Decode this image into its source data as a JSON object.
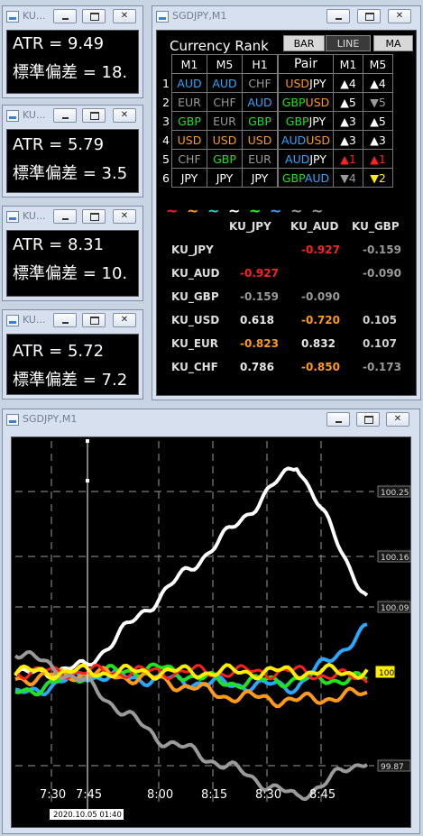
{
  "atr_windows": [
    {
      "title": "KU...",
      "atr_text": "ATR = 9.49",
      "sd_text": "標準偏差 = 18."
    },
    {
      "title": "KU...",
      "atr_text": "ATR = 5.79",
      "sd_text": "標準偏差 = 3.5"
    },
    {
      "title": "KU...",
      "atr_text": "ATR = 8.31",
      "sd_text": "標準偏差 = 10."
    },
    {
      "title": "KU...",
      "atr_text": "ATR = 5.72",
      "sd_text": "標準偏差 = 7.2"
    }
  ],
  "rank_window": {
    "title": "SGDJPY,M1",
    "heading": "Currency Rank",
    "tabs": [
      "BAR",
      "LINE",
      "MA"
    ],
    "active_tab": "LINE",
    "headers": [
      "M1",
      "M5",
      "H1",
      "Pair",
      "M1",
      "M5"
    ],
    "rows": [
      {
        "n": "1",
        "m1": "AUD",
        "m5": "AUD",
        "h1": "CHF",
        "pair_a": "USD",
        "pair_b": "JPY",
        "pm1": "▲4",
        "pm5": "▲4"
      },
      {
        "n": "2",
        "m1": "EUR",
        "m5": "CHF",
        "h1": "AUD",
        "pair_a": "GBP",
        "pair_b": "USD",
        "pm1": "▲5",
        "pm5": "▼5"
      },
      {
        "n": "3",
        "m1": "GBP",
        "m5": "EUR",
        "h1": "GBP",
        "pair_a": "GBP",
        "pair_b": "JPY",
        "pm1": "▲3",
        "pm5": "▲5"
      },
      {
        "n": "4",
        "m1": "USD",
        "m5": "USD",
        "h1": "USD",
        "pair_a": "AUD",
        "pair_b": "USD",
        "pm1": "▲3",
        "pm5": "▲3"
      },
      {
        "n": "5",
        "m1": "CHF",
        "m5": "GBP",
        "h1": "EUR",
        "pair_a": "AUD",
        "pair_b": "JPY",
        "pm1": "▲1",
        "pm5": "▲1"
      },
      {
        "n": "6",
        "m1": "JPY",
        "m5": "JPY",
        "h1": "JPY",
        "pair_a": "GBP",
        "pair_b": "AUD",
        "pm1": "▼4",
        "pm5": "▼2"
      }
    ],
    "corr_cols": [
      "KU_JPY",
      "KU_AUD",
      "KU_GBP"
    ],
    "corr_rows": [
      {
        "name": "KU_JPY",
        "v": [
          "",
          "-0.927",
          "-0.159"
        ]
      },
      {
        "name": "KU_AUD",
        "v": [
          "-0.927",
          "",
          "-0.090"
        ]
      },
      {
        "name": "KU_GBP",
        "v": [
          "-0.159",
          "-0.090",
          ""
        ]
      },
      {
        "name": "KU_USD",
        "v": [
          "0.618",
          "-0.720",
          "0.105"
        ]
      },
      {
        "name": "KU_EUR",
        "v": [
          "-0.823",
          "0.832",
          "0.107"
        ]
      },
      {
        "name": "KU_CHF",
        "v": [
          "0.786",
          "-0.850",
          "-0.173"
        ]
      }
    ],
    "swatch_glyph": "~",
    "swatch_colors": [
      "#ff2020",
      "#ff9a1a",
      "#22d2d2",
      "#ffffff",
      "#1aff1a",
      "#3aa0ff",
      "#999999",
      "#999999"
    ]
  },
  "colors": {
    "JPY": "#ffffff",
    "AUD": "#2aa8ff",
    "CHF": "#9a9a9a",
    "EUR": "#9a9a9a",
    "GBP": "#22e022",
    "USD": "#ff9a1a",
    "up": "#ffffff",
    "down": "#9a9a9a",
    "alert_red": "#ff2020",
    "alert_yellow": "#ffee00"
  },
  "chart_window": {
    "title": "SGDJPY,M1",
    "price_labels": [
      "100.25",
      "100.16",
      "100.09",
      "100",
      "99.87"
    ],
    "time_labels": [
      "7:30",
      "7:45",
      "8:00",
      "8:15",
      "8:30",
      "8:45"
    ],
    "cursor_label": "2020.10.05 01:40"
  },
  "chart_data": {
    "type": "line",
    "x": [
      "7:30",
      "7:45",
      "8:00",
      "8:15",
      "8:30",
      "8:45"
    ],
    "ylim": [
      99.82,
      100.32
    ],
    "yticks": [
      100.25,
      100.16,
      100.09,
      100,
      99.87
    ],
    "series": [
      {
        "color": "#ffffff",
        "values": [
          99.995,
          100.007,
          100.1,
          100.19,
          100.29,
          100.1
        ]
      },
      {
        "color": "#2aa8ff",
        "values": [
          99.967,
          99.995,
          99.99,
          99.983,
          99.98,
          100.06
        ]
      },
      {
        "color": "#22e022",
        "values": [
          99.97,
          99.996,
          100.005,
          99.985,
          99.99,
          99.99
        ]
      },
      {
        "color": "#ff9a1a",
        "values": [
          99.99,
          99.998,
          99.99,
          99.967,
          99.96,
          99.97
        ]
      },
      {
        "color": "#ff2020",
        "values": [
          100.0,
          100.0,
          100.0,
          100.0,
          100.0,
          99.99
        ]
      },
      {
        "color": "#9a9a9a",
        "values": [
          100.03,
          99.985,
          99.91,
          99.87,
          99.825,
          99.88
        ]
      },
      {
        "color": "#ffee00",
        "values": [
          100.0,
          100.0,
          100.0,
          100.0,
          100.0,
          100.0
        ]
      }
    ]
  }
}
